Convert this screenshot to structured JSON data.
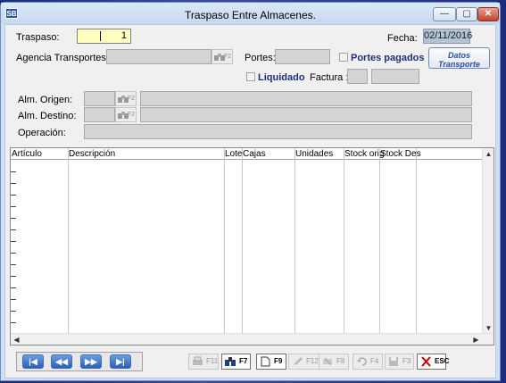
{
  "window": {
    "title": "Traspaso Entre Almacenes.",
    "icon_text": "SB",
    "minimize": "—",
    "maximize": "▢",
    "close": "✕"
  },
  "form": {
    "traspaso_label": "Traspaso:",
    "traspaso_value": "1",
    "fecha_label": "Fecha:",
    "fecha_value": "02/11/2016",
    "agencia_label": "Agencia Transportes:",
    "portes_label": "Portes:",
    "portes_pagados_label": "Portes pagados",
    "liquidado_label": "Liquidado",
    "factura_label": "Factura :",
    "datos_transporte_button": [
      "Datos",
      "Transporte"
    ],
    "alm_origen_label": "Alm. Origen:",
    "alm_destino_label": "Alm. Destino:",
    "operacion_label": "Operación:",
    "f2_key": "F2"
  },
  "grid": {
    "columns": [
      "Artículo",
      "Descripción",
      "Lote",
      "Cajas",
      "Unidades",
      "Stock orig",
      "Stock Des"
    ],
    "rows": []
  },
  "nav": {
    "first": "|◀",
    "prev": "◀◀",
    "next": "▶▶",
    "last": "▶|"
  },
  "toolbar": {
    "print": "F11",
    "add": "F7",
    "new": "F9",
    "refresh": "F12",
    "delete": "F8",
    "undo": "F4",
    "save": "F3",
    "exit": "ESC"
  },
  "colors": {
    "accent": "#1c2f7c",
    "date_bg": "#b4c2d2",
    "input_yellow": "#ffffc0",
    "exit_red": "#c00000"
  }
}
